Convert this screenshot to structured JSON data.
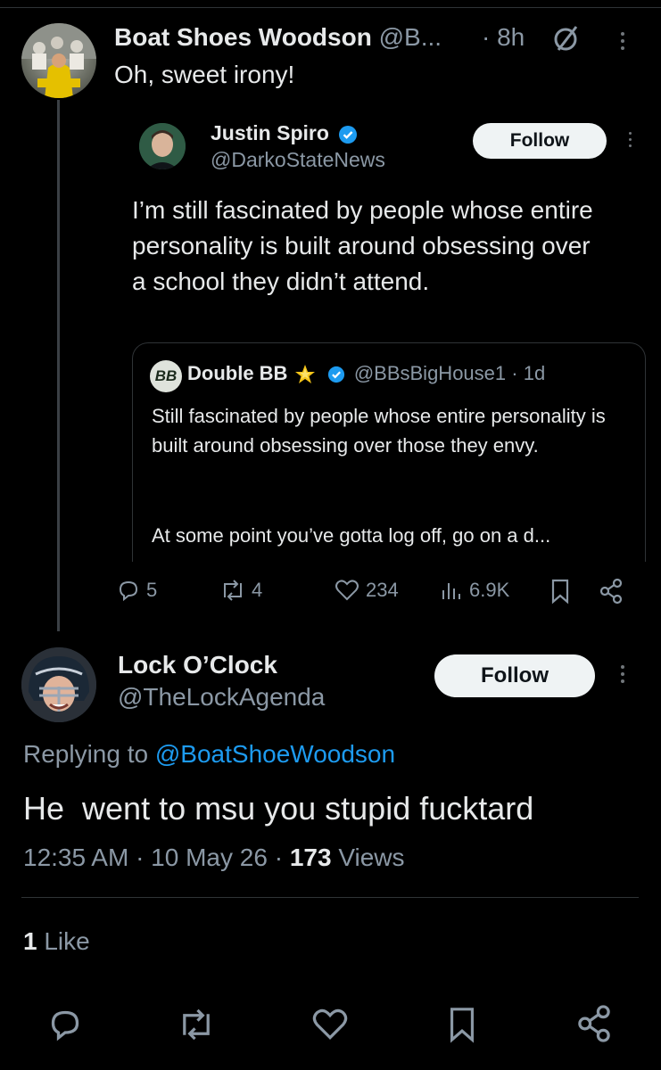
{
  "tweet": {
    "author_name": "Boat Shoes Woodson",
    "author_handle": "@B...",
    "time": "· 8h",
    "text": "Oh, sweet irony!"
  },
  "quoted": {
    "author_name": "Justin Spiro",
    "author_handle": "@DarkoStateNews",
    "follow_label": "Follow",
    "text": "I’m still fascinated by people whose entire personality is built around obsessing over a school they didn’t attend.",
    "nested": {
      "avatar_text": "BB",
      "author_name": "Double BB",
      "author_handle": "@BBsBigHouse1",
      "time": "· 1d",
      "text1": "Still fascinated by people whose entire personality is built around obsessing over those they envy.",
      "text2": "At some point you’ve gotta log off, go on a d..."
    }
  },
  "actions": {
    "replies": "5",
    "reposts": "4",
    "likes": "234",
    "views": "6.9K"
  },
  "reply": {
    "author_name": "Lock O’Clock",
    "author_handle": "@TheLockAgenda",
    "follow_label": "Follow",
    "replying_prefix": "Replying to",
    "replying_handle": "@BoatShoeWoodson",
    "text": "He  went to msu you stupid fucktard",
    "time_date": "12:35 AM · 10 May 26 ·",
    "views_count": "173",
    "views_label": "Views",
    "likes_count": "1",
    "likes_label": "Like"
  },
  "colors": {
    "background": "#000000",
    "text": "#e7e9ea",
    "muted": "#8b98a5",
    "link": "#1d9bf0",
    "verified": "#1d9bf0",
    "divider": "#2f3336"
  },
  "icons": [
    "verified-badge-icon",
    "grok-slash-icon",
    "more-dots-icon",
    "reply-icon",
    "repost-icon",
    "like-icon",
    "views-icon",
    "bookmark-icon",
    "share-icon",
    "star-emoji-icon"
  ]
}
